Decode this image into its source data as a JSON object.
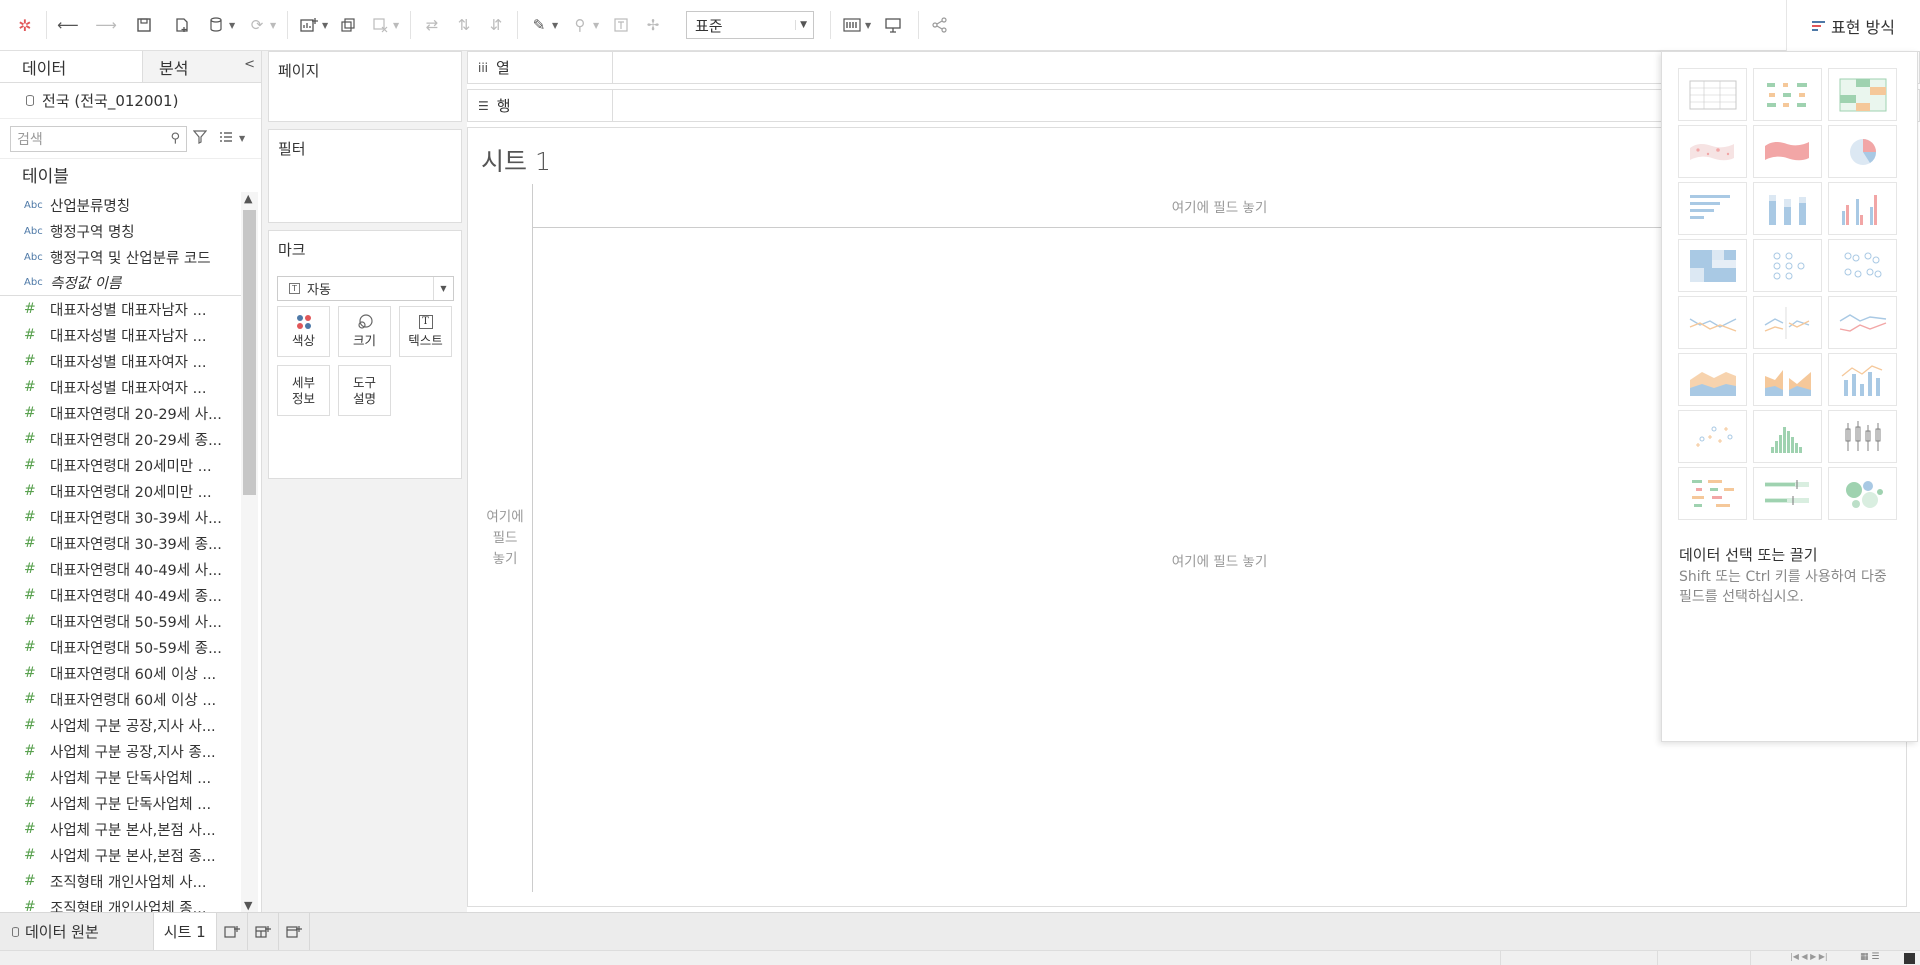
{
  "toolbar": {
    "view_select": "표준",
    "show_me_label": "표현 방식"
  },
  "left_pane": {
    "tab_data": "데이터",
    "tab_analysis": "분석",
    "datasource": "전국 (전국_012001)",
    "search_placeholder": "검색",
    "tables_title": "테이블",
    "fields": [
      {
        "type": "Abc",
        "label": "산업분류명칭"
      },
      {
        "type": "Abc",
        "label": "행정구역 명칭"
      },
      {
        "type": "Abc",
        "label": "행정구역 및 산업분류 코드"
      },
      {
        "type": "Abc",
        "label": "측정값 이름"
      },
      {
        "type": "#",
        "label": "대표자성별 대표자남자 ..."
      },
      {
        "type": "#",
        "label": "대표자성별 대표자남자 ..."
      },
      {
        "type": "#",
        "label": "대표자성별 대표자여자 ..."
      },
      {
        "type": "#",
        "label": "대표자성별 대표자여자 ..."
      },
      {
        "type": "#",
        "label": "대표자연령대 20-29세 사..."
      },
      {
        "type": "#",
        "label": "대표자연령대 20-29세 종..."
      },
      {
        "type": "#",
        "label": "대표자연령대 20세미만 ..."
      },
      {
        "type": "#",
        "label": "대표자연령대 20세미만 ..."
      },
      {
        "type": "#",
        "label": "대표자연령대 30-39세 사..."
      },
      {
        "type": "#",
        "label": "대표자연령대 30-39세 종..."
      },
      {
        "type": "#",
        "label": "대표자연령대 40-49세 사..."
      },
      {
        "type": "#",
        "label": "대표자연령대 40-49세 종..."
      },
      {
        "type": "#",
        "label": "대표자연령대 50-59세 사..."
      },
      {
        "type": "#",
        "label": "대표자연령대 50-59세 종..."
      },
      {
        "type": "#",
        "label": "대표자연령대 60세 이상 ..."
      },
      {
        "type": "#",
        "label": "대표자연령대 60세 이상 ..."
      },
      {
        "type": "#",
        "label": "사업체 구분 공장,지사 사..."
      },
      {
        "type": "#",
        "label": "사업체 구분 공장,지사 종..."
      },
      {
        "type": "#",
        "label": "사업체 구분 단독사업체 ..."
      },
      {
        "type": "#",
        "label": "사업체 구분 단독사업체 ..."
      },
      {
        "type": "#",
        "label": "사업체 구분 본사,본점 사..."
      },
      {
        "type": "#",
        "label": "사업체 구분 본사,본점 종..."
      },
      {
        "type": "#",
        "label": "조직형태 개인사업체 사..."
      },
      {
        "type": "#",
        "label": "조직형태 개인사업체 종..."
      }
    ]
  },
  "shelves": {
    "pages": "페이지",
    "filters": "필터",
    "marks": "마크",
    "mark_type": "자동",
    "mark_buttons": {
      "color": "색상",
      "size": "크기",
      "text": "텍스트",
      "detail_1": "세부",
      "detail_2": "정보",
      "tooltip_1": "도구",
      "tooltip_2": "설명"
    },
    "columns": "열",
    "rows": "행"
  },
  "worksheet": {
    "title": "시트 1",
    "drop_top": "여기에 필드 놓기",
    "drop_left_1": "여기에",
    "drop_left_2": "필드",
    "drop_left_3": "놓기",
    "drop_center": "여기에 필드 놓기"
  },
  "show_me": {
    "title": "데이터 선택 또는 끌기",
    "description": "Shift 또는 Ctrl 키를 사용하여 다중 필드를 선택하십시오.",
    "chart_types": [
      "text-table",
      "heat-map",
      "highlight-table",
      "symbol-map",
      "filled-map",
      "pie-chart",
      "horizontal-bars",
      "stacked-bars",
      "side-by-side-bars",
      "treemap",
      "circle-views",
      "side-by-side-circles",
      "continuous-lines",
      "discrete-lines",
      "dual-lines",
      "area-continuous",
      "area-discrete",
      "dual-combination",
      "scatter-plot",
      "histogram",
      "box-whisker",
      "gantt-chart",
      "bullet-graph",
      "packed-bubbles"
    ]
  },
  "bottom": {
    "datasource_tab": "데이터 원본",
    "sheet_tab": "시트 1"
  },
  "colors": {
    "accent_blue": "#4e79a7",
    "measure_green": "#59a14f",
    "panel_bg": "#f2f2f2"
  }
}
